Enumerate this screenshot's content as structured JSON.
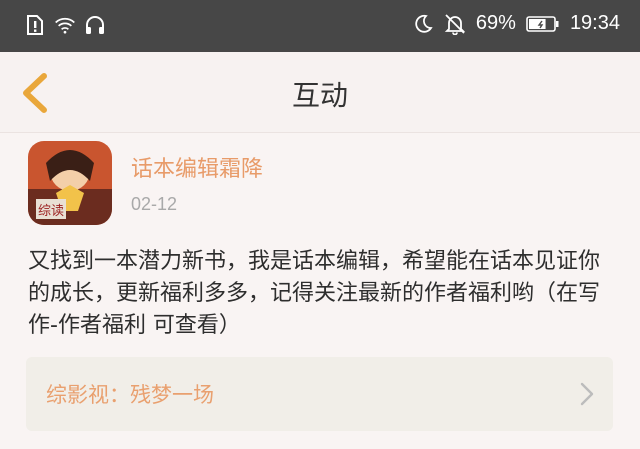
{
  "status_bar": {
    "battery_percent": "69%",
    "battery_level": 0.69,
    "time": "19:34",
    "icons_left": [
      "sim-alert-icon",
      "wifi-question-icon",
      "headset-icon"
    ],
    "icons_right": [
      "moon-icon",
      "bell-off-icon",
      "battery-icon"
    ]
  },
  "header": {
    "title": "互动",
    "back_icon": "chevron-left-icon"
  },
  "message": {
    "author": "话本编辑霜降",
    "date": "02-12",
    "avatar_badge": "综读",
    "text": "又找到一本潜力新书，我是话本编辑，希望能在话本见证你的成长，更新福利多多，记得关注最新的作者福利哟（在写作-作者福利 可查看）",
    "book_link": "综影视：残梦一场"
  },
  "colors": {
    "status_bar_bg": "#474747",
    "accent_orange": "#e89b69",
    "back_arrow": "#e9a73b",
    "page_bg": "#f8f3f2",
    "link_card_bg": "#f1eee8"
  }
}
